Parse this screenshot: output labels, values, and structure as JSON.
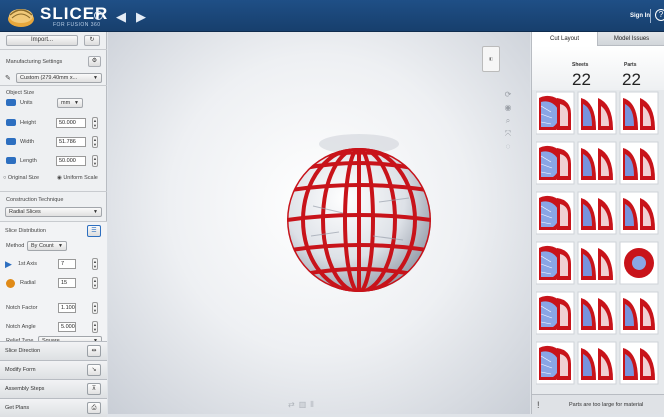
{
  "app": {
    "brand": "SLICER",
    "brand_sub": "FOR FUSION 360",
    "sign_in": "Sign In"
  },
  "left": {
    "import_label": "Import...",
    "manufacturing_settings_label": "Manufacturing Settings",
    "manufacturing_preset": "Custom (279.40mm x...",
    "object_size_label": "Object Size",
    "units_label": "Units",
    "units_value": "mm",
    "height_label": "Height",
    "height_value": "50.000",
    "width_label": "Width",
    "width_value": "51.786",
    "length_label": "Length",
    "length_value": "50.000",
    "original_size_label": "Original Size",
    "uniform_scale_label": "Uniform Scale",
    "construction_label": "Construction Technique",
    "construction_value": "Radial Slices",
    "slice_distribution_label": "Slice Distribution",
    "method_label": "Method",
    "method_value": "By Count",
    "axis1_label": "1st Axis",
    "axis1_value": "7",
    "radial_label": "Radial",
    "radial_value": "15",
    "notch_factor_label": "Notch Factor",
    "notch_factor_value": "1.100",
    "notch_angle_label": "Notch Angle",
    "notch_angle_value": "5.000",
    "relief_type_label": "Relief Type",
    "relief_type_value": "Square",
    "bottom_items": [
      "Slice Direction",
      "Modify Form",
      "Assembly Steps",
      "Get Plans"
    ]
  },
  "right": {
    "tabs": [
      "Cut Layout",
      "Model Issues"
    ],
    "sheets_label": "Sheets",
    "sheets_value": "22",
    "parts_label": "Parts",
    "parts_value": "22",
    "warning": "Parts are too large for material"
  },
  "colors": {
    "topbar": "#1f4f86",
    "slice_red": "#c8131a",
    "accent_blue": "#2d6fc0",
    "radial_orange": "#e08a17"
  }
}
